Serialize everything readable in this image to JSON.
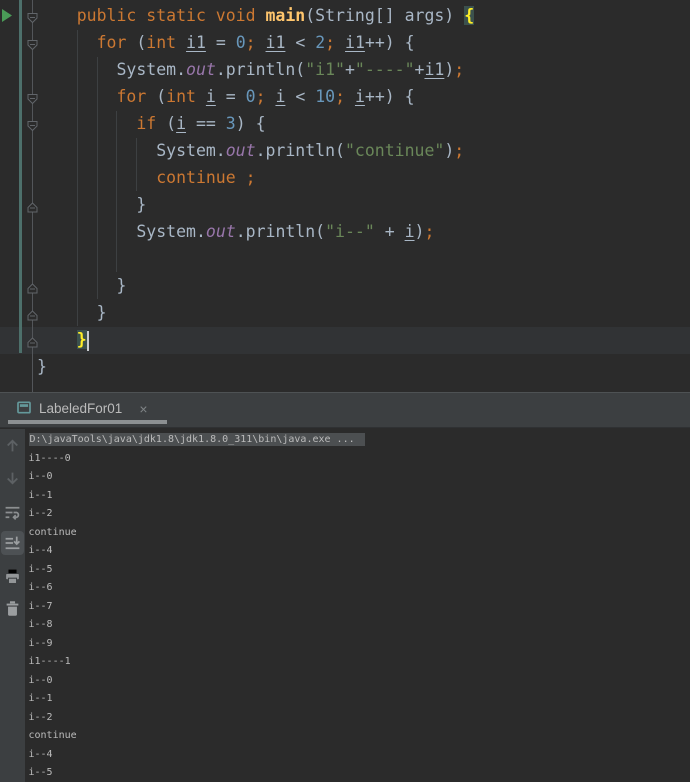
{
  "colors": {
    "editor_bg": "#2b2b2b",
    "panel_bg": "#3c3f41",
    "keyword": "#cc7832",
    "function": "#ffc66d",
    "string": "#6a8759",
    "number": "#6897bb",
    "plain": "#a9b7c6",
    "semicolon": "#cc7832",
    "field": "#9876aa",
    "brace_match_fg": "#ffef28",
    "brace_match_bg": "#3b514d",
    "current_line": "#313335",
    "console_text": "#bbbbbb",
    "cmd_highlight": "#4c4f51",
    "vcs_added": "#4d706b",
    "run_green": "#4a9b57",
    "tab_underline": "#8c9092"
  },
  "editor": {
    "gutter_icons": [
      "run-icon",
      "fold-open-icon",
      "fold-close-icon"
    ],
    "code": [
      [
        "    public static void ",
        "main",
        "(String[] args) ",
        "{"
      ],
      [
        "      for ",
        "(",
        "int ",
        "i1",
        " = ",
        "0",
        "; ",
        "i1",
        " < ",
        "2",
        "; ",
        "i1",
        "++) {"
      ],
      [
        "        System.",
        "out",
        ".println(",
        "\"i1\"",
        "+",
        "\"----\"",
        "+",
        "i1",
        ")",
        ";"
      ],
      [
        "        for ",
        "(",
        "int ",
        "i",
        " = ",
        "0",
        "; ",
        "i",
        " < ",
        "10",
        "; ",
        "i",
        "++) {"
      ],
      [
        "          if ",
        "(",
        "i",
        " == ",
        "3",
        ") {"
      ],
      [
        "            System.",
        "out",
        ".println(",
        "\"continue\"",
        ")",
        ";"
      ],
      [
        "            continue",
        " ",
        ";"
      ],
      [
        "          }"
      ],
      [
        "          System.",
        "out",
        ".println(",
        "\"i--\"",
        " + ",
        "i",
        ")",
        ";"
      ],
      [
        ""
      ],
      [
        "        }"
      ],
      [
        "      }"
      ],
      [
        "    ",
        "}"
      ],
      [
        "}"
      ]
    ]
  },
  "console": {
    "tab_title": "LabeledFor01",
    "close_glyph": "×",
    "toolbar_icons": [
      "up-arrow-icon",
      "down-arrow-icon",
      "soft-wrap-icon",
      "scroll-to-end-icon",
      "print-icon",
      "clear-trash-icon"
    ],
    "command": "D:\\javaTools\\java\\jdk1.8\\jdk1.8.0_311\\bin\\java.exe ...",
    "lines": [
      "i1----0",
      "i--0",
      "i--1",
      "i--2",
      "continue",
      "i--4",
      "i--5",
      "i--6",
      "i--7",
      "i--8",
      "i--9",
      "i1----1",
      "i--0",
      "i--1",
      "i--2",
      "continue",
      "i--4",
      "i--5"
    ]
  }
}
